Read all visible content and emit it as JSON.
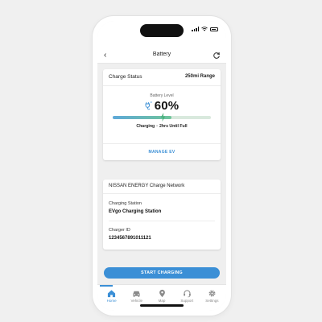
{
  "status_bar": {
    "time": ""
  },
  "nav": {
    "back_glyph": "‹",
    "title": "Battery",
    "refresh_icon": "refresh-icon"
  },
  "charge_status": {
    "title": "Charge Status",
    "range": "250mi Range",
    "battery_level_label": "Battery Level",
    "percent_text": "60%",
    "percent_value": 0.6,
    "charging_label": "Charging",
    "time_until_full": "2hrs Until Full",
    "manage_link": "MANAGE EV"
  },
  "network": {
    "title": "NISSAN ENERGY Charge Network",
    "station_label": "Charging Station",
    "station_value": "EVgo Charging Station",
    "charger_label": "Charger ID",
    "charger_value": "1234567891011121"
  },
  "start_button": "START CHARGING",
  "tabs": [
    {
      "label": "Home",
      "icon": "home-icon",
      "active": true
    },
    {
      "label": "Vehicle",
      "icon": "car-icon",
      "active": false
    },
    {
      "label": "Map",
      "icon": "map-pin-icon",
      "active": false
    },
    {
      "label": "Support",
      "icon": "headset-icon",
      "active": false
    },
    {
      "label": "Settings",
      "icon": "gear-icon",
      "active": false
    }
  ],
  "colors": {
    "accent": "#3b8fd6",
    "bar_start": "#5fa9d9",
    "bar_end": "#6fc59a",
    "bar_track": "#d9e9dd"
  }
}
